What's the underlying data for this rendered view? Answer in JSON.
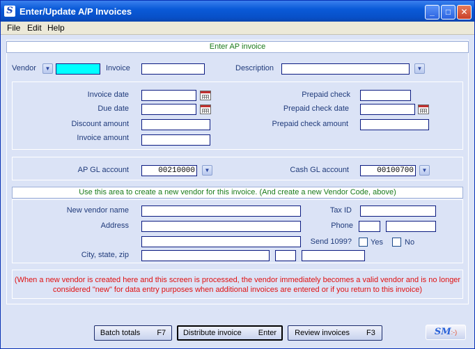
{
  "window": {
    "title": "Enter/Update A/P Invoices",
    "app_icon": "S",
    "controls": {
      "minimize": "_",
      "maximize": "□",
      "close": "✕"
    }
  },
  "menu": {
    "file": "File",
    "edit": "Edit",
    "help": "Help"
  },
  "header_bar": "Enter AP invoice",
  "top_row": {
    "vendor_label": "Vendor",
    "vendor_value": "",
    "invoice_label": "Invoice",
    "invoice_value": "",
    "description_label": "Description",
    "description_value": ""
  },
  "dates_group": {
    "invoice_date_label": "Invoice date",
    "invoice_date_value": "",
    "due_date_label": "Due date",
    "due_date_value": "",
    "discount_amount_label": "Discount amount",
    "discount_amount_value": "",
    "invoice_amount_label": "Invoice amount",
    "invoice_amount_value": "",
    "prepaid_check_label": "Prepaid check",
    "prepaid_check_value": "",
    "prepaid_check_date_label": "Prepaid check date",
    "prepaid_check_date_value": "",
    "prepaid_check_amount_label": "Prepaid check amount",
    "prepaid_check_amount_value": ""
  },
  "gl_group": {
    "ap_gl_label": "AP GL account",
    "ap_gl_value": "00210000",
    "cash_gl_label": "Cash GL account",
    "cash_gl_value": "00100700"
  },
  "new_vendor_bar": "Use this area to create a new vendor for this invoice. (And create a new Vendor Code, above)",
  "new_vendor": {
    "name_label": "New vendor name",
    "name_value": "",
    "address_label": "Address",
    "address1_value": "",
    "address2_value": "",
    "city_label": "City, state, zip",
    "city_value": "",
    "state_value": "",
    "zip_value": "",
    "taxid_label": "Tax ID",
    "taxid_value": "",
    "phone_label": "Phone",
    "phone_area_value": "",
    "phone_number_value": "",
    "send1099_label": "Send 1099?",
    "yes_label": "Yes",
    "no_label": "No"
  },
  "note_line1": "(When a new vendor is created here and this screen is processed, the vendor immediately becomes a valid vendor and is no longer",
  "note_line2": "considered \"new\" for data entry purposes when additional invoices are entered or if you return to this invoice)",
  "buttons": {
    "batch_totals": "Batch totals",
    "batch_totals_key": "F7",
    "distribute": "Distribute invoice",
    "distribute_key": "Enter",
    "review": "Review invoices",
    "review_key": "F3"
  },
  "logo": {
    "text": "SM",
    "smile": ":-)"
  }
}
